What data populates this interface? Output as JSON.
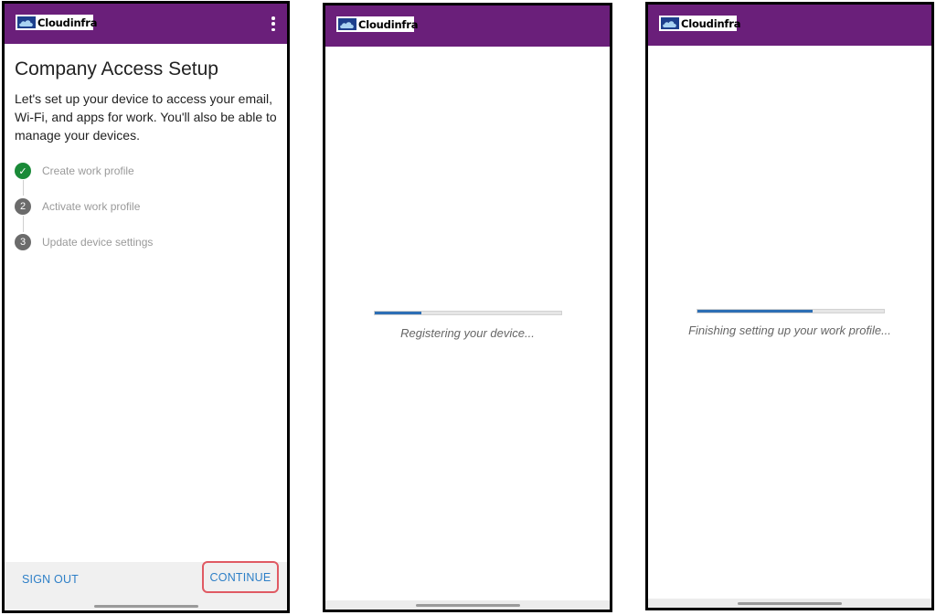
{
  "brand": {
    "name": "Cloudinfra",
    "bar_color": "#6a1f7a"
  },
  "screen1": {
    "title": "Company Access Setup",
    "description": "Let's set up your device to access your email, Wi-Fi, and apps for work. You'll also be able to manage your devices.",
    "steps": [
      {
        "badge": "✓",
        "label": "Create work profile",
        "state": "done"
      },
      {
        "badge": "2",
        "label": "Activate work profile",
        "state": "pending"
      },
      {
        "badge": "3",
        "label": "Update device settings",
        "state": "pending"
      }
    ],
    "sign_out_label": "SIGN OUT",
    "continue_label": "CONTINUE",
    "menu_icon": "more-vert-icon"
  },
  "screen2": {
    "status": "Registering your device...",
    "progress": 0.25
  },
  "screen3": {
    "status": "Finishing setting up your work profile...",
    "progress": 0.62
  },
  "colors": {
    "accent": "#2d7fc7",
    "success": "#1a8a38",
    "highlight": "#e05a63",
    "progress": "#2d6fb5"
  }
}
